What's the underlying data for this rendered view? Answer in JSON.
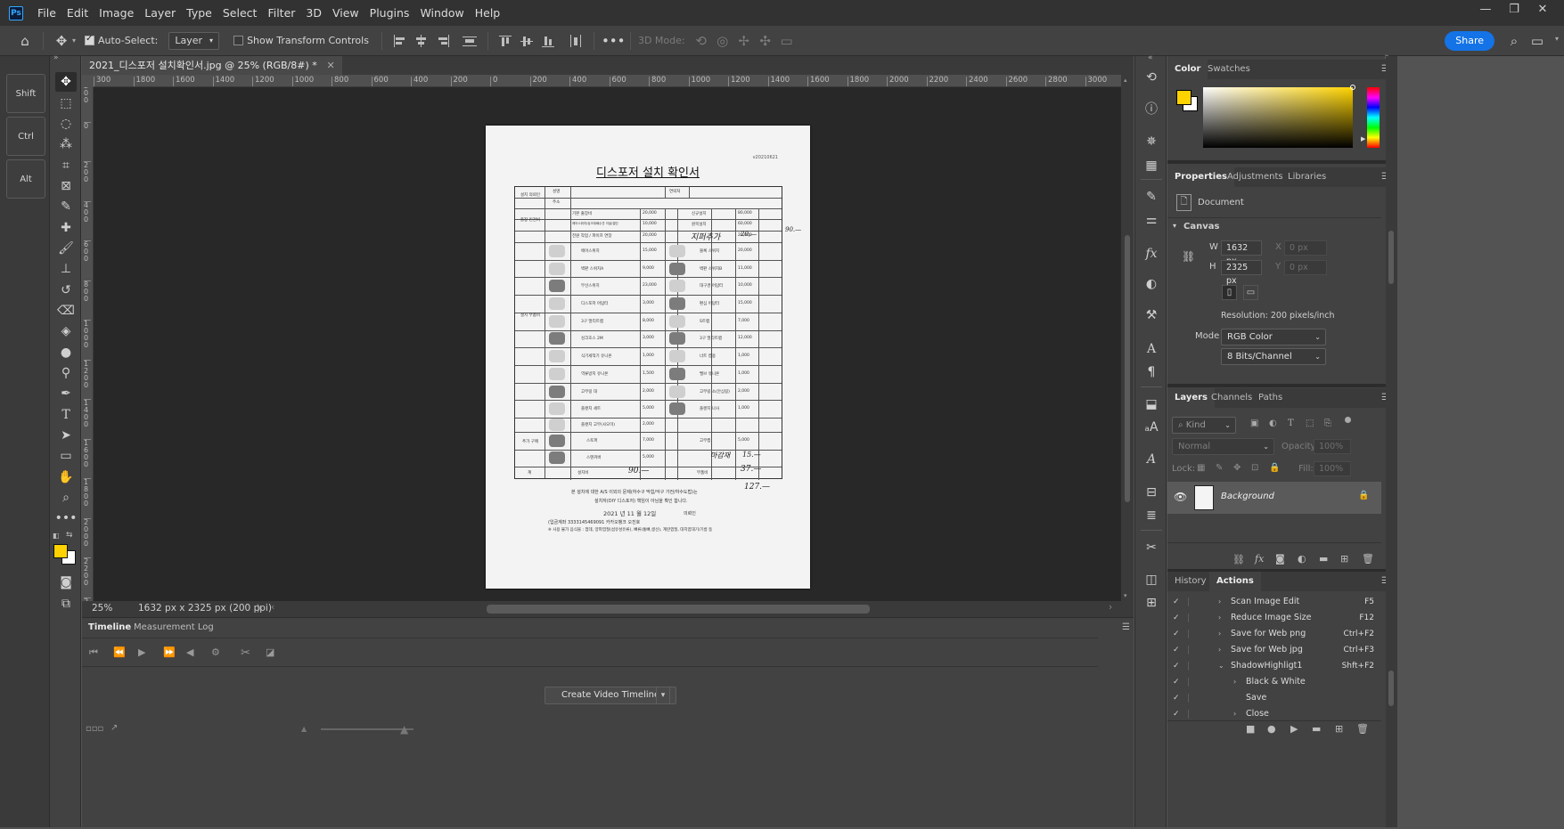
{
  "app": {
    "logo": "Ps"
  },
  "menu": [
    "File",
    "Edit",
    "Image",
    "Layer",
    "Type",
    "Select",
    "Filter",
    "3D",
    "View",
    "Plugins",
    "Window",
    "Help"
  ],
  "window_controls": {
    "minimize": "—",
    "restore": "❐",
    "close": "✕"
  },
  "options_bar": {
    "auto_select_label": "Auto-Select:",
    "auto_select_checked": true,
    "auto_select_target": "Layer",
    "show_transform_label": "Show Transform Controls",
    "show_transform_checked": false,
    "mode_3d_label": "3D Mode:",
    "share_label": "Share"
  },
  "modifier_keys": [
    "Shift",
    "Ctrl",
    "Alt"
  ],
  "document": {
    "tab_title": "2021_디스포저 설치확인서.jpg @ 25% (RGB/8#) *",
    "zoom": "25%",
    "size_info": "1632 px x 2325 px (200 ppi)"
  },
  "rulers": {
    "h_ticks": [
      "300",
      "1800",
      "1600",
      "1400",
      "1200",
      "1000",
      "800",
      "600",
      "400",
      "200",
      "0",
      "200",
      "400",
      "600",
      "800",
      "1000",
      "1200",
      "1400",
      "1600",
      "1800",
      "2000",
      "2200",
      "2400",
      "2600",
      "2800",
      "3000"
    ],
    "v_ticks": [
      "200",
      "0",
      "200",
      "400",
      "600",
      "800",
      "1000",
      "1200",
      "1400",
      "1600",
      "1800",
      "2000",
      "2200",
      "2400"
    ]
  },
  "paper": {
    "code": "v20210621",
    "title": "디스포저 설치 확인서",
    "section_installer": "설치 의뢰인",
    "label_name": "성명",
    "label_contact": "연락처",
    "label_address": "주소",
    "section_travel": "출장 인건비",
    "section_parts": "설치 부품비",
    "section_extra": "추가 구매",
    "total_label": "계",
    "fee_rows": [
      {
        "left": "기본 출장비",
        "left_price": "20,000",
        "right": "신규설치",
        "right_price": "80,000"
      },
      {
        "left": "에어스위치/싱크대배수관 이설/절단",
        "left_price": "10,000",
        "right": "원목설치",
        "right_price": "60,000"
      },
      {
        "left": "전원 작업 / 파이프 연장",
        "left_price": "20,000",
        "right": "",
        "right_price": "20,000"
      }
    ],
    "parts": [
      {
        "left": "에어스위치",
        "left_price": "15,000",
        "right": "볼록 스위치",
        "right_price": "20,000"
      },
      {
        "left": "벽판 스위치A",
        "left_price": "9,000",
        "right": "벽판 스위치B",
        "right_price": "11,000"
      },
      {
        "left": "무선스위치",
        "left_price": "23,000",
        "right": "대구경 어답터",
        "right_price": "10,000"
      },
      {
        "left": "디스포저 어답터",
        "left_price": "3,000",
        "right": "편심 어답터",
        "right_price": "15,000"
      },
      {
        "left": "3구 멀티트랩",
        "left_price": "8,000",
        "right": "S트랩",
        "right_price": "7,000"
      },
      {
        "left": "싱크호스 2M",
        "left_price": "3,000",
        "right": "3구 멀티트랩",
        "right_price": "12,000"
      },
      {
        "left": "식기세척기 유니온",
        "left_price": "1,000",
        "right": "너트 캡용",
        "right_price": "1,000"
      },
      {
        "left": "역류방지 유니온",
        "left_price": "1,500",
        "right": "밸브 유니온",
        "right_price": "1,000"
      },
      {
        "left": "고무링 대",
        "left_price": "2,000",
        "right": "고무링 소(안심링)",
        "right_price": "2,000"
      },
      {
        "left": "플랜지 세트",
        "left_price": "5,000",
        "right": "플랜지 나사",
        "right_price": "1,000"
      },
      {
        "left": "플랜지 고무(사오미)",
        "left_price": "2,000",
        "right": "",
        "right_price": ""
      }
    ],
    "extra": [
      {
        "left": "스토퍼",
        "left_price": "7,000",
        "right": "고무캡",
        "right_price": "5,000"
      },
      {
        "left": "스텐커버",
        "left_price": "5,000",
        "right": "",
        "right_price": ""
      }
    ],
    "total_row": {
      "left": "설치비",
      "right": "부품비"
    },
    "hand": {
      "extra1": "지퍼추가",
      "extra1_price": "20,—",
      "side": "90.—",
      "extra_bottom": "마감재",
      "extra_bottom_price": "15.—",
      "install_total": "90.—",
      "parts_total": "37.—",
      "grand": "127.—",
      "date": "2021 년 11 월 12일"
    },
    "footer_line1": "본 설치에 대한 A/S 이외의 문제(하수구 막힘/악구 가전/하수도법)는",
    "footer_line2": "설치자(DIY 디스포저) 책임이 아님을 확인 합니다.",
    "footer_sign": "의뢰인",
    "footer_account": "(입금계좌 3333145469091 카카오뱅크 오진호",
    "footer_note": "※ 사용 불가 음식물 : 껍데, 양파껍질(섬유성유류), 뼈류(통뼈,생선), 계란껍질, 대지엽대기/기름 등"
  },
  "timeline": {
    "tabs": [
      "Timeline",
      "Measurement Log"
    ],
    "create_button": "Create Video Timeline"
  },
  "color_panel": {
    "tabs": [
      "Color",
      "Swatches"
    ],
    "foreground": "#ffd200",
    "background": "#ffffff"
  },
  "properties_panel": {
    "tabs": [
      "Properties",
      "Adjustments",
      "Libraries"
    ],
    "doc_label": "Document",
    "canvas_label": "Canvas",
    "w_label": "W",
    "w_value": "1632 px",
    "h_label": "H",
    "h_value": "2325 px",
    "x_label": "X",
    "x_value": "0 px",
    "y_label": "Y",
    "y_value": "0 px",
    "resolution": "Resolution: 200 pixels/inch",
    "mode_label": "Mode",
    "mode_value": "RGB Color",
    "depth_value": "8 Bits/Channel"
  },
  "layers_panel": {
    "tabs": [
      "Layers",
      "Channels",
      "Paths"
    ],
    "kind_placeholder": "Kind",
    "blend_mode": "Normal",
    "opacity_label": "Opacity:",
    "opacity_value": "100%",
    "lock_label": "Lock:",
    "fill_label": "Fill:",
    "fill_value": "100%",
    "layer_name": "Background"
  },
  "history_panel": {
    "tabs": [
      "History",
      "Actions"
    ],
    "actions": [
      {
        "name": "Scan Image Edit",
        "key": "F5",
        "indent": 0,
        "expanded": false
      },
      {
        "name": "Reduce Image Size",
        "key": "F12",
        "indent": 0,
        "expanded": false
      },
      {
        "name": "Save for Web png",
        "key": "Ctrl+F2",
        "indent": 0,
        "expanded": false
      },
      {
        "name": "Save for Web jpg",
        "key": "Ctrl+F3",
        "indent": 0,
        "expanded": false
      },
      {
        "name": "ShadowHighligt1",
        "key": "Shft+F2",
        "indent": 0,
        "expanded": true
      },
      {
        "name": "Black & White",
        "key": "",
        "indent": 1,
        "expanded": false
      },
      {
        "name": "Save",
        "key": "",
        "indent": 1,
        "expanded": null
      },
      {
        "name": "Close",
        "key": "",
        "indent": 1,
        "expanded": false
      }
    ]
  }
}
